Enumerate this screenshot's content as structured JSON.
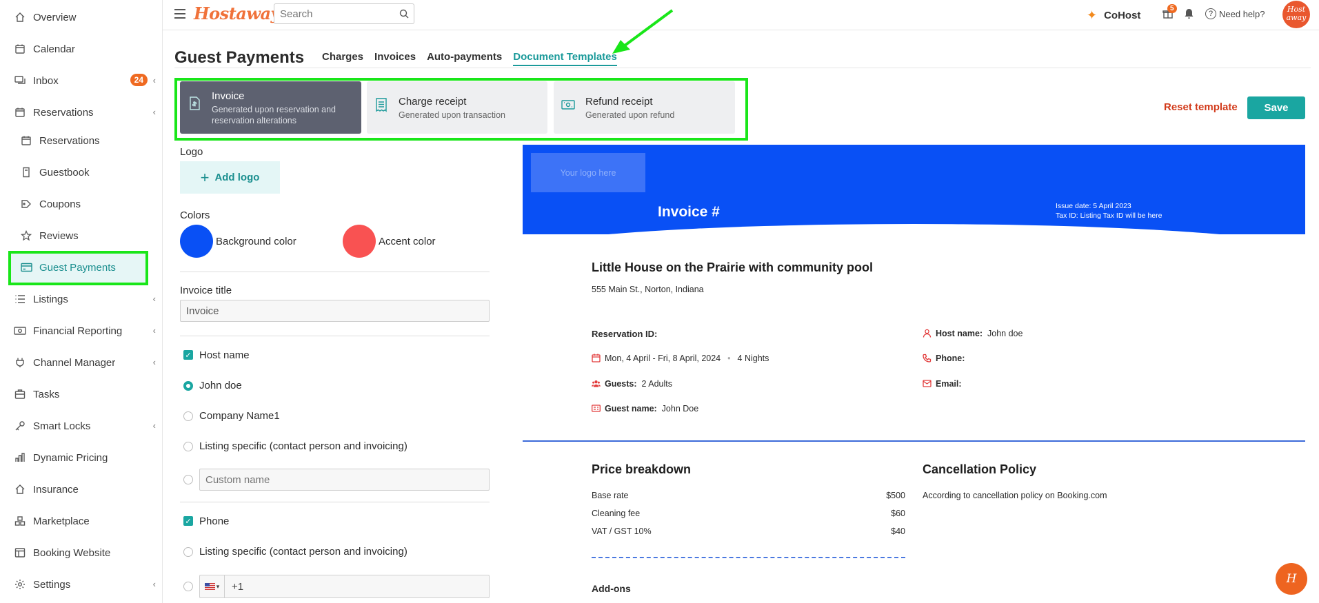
{
  "sidebar": {
    "items": [
      {
        "label": "Overview",
        "icon": "home-icon"
      },
      {
        "label": "Calendar",
        "icon": "calendar-icon"
      },
      {
        "label": "Inbox",
        "icon": "inbox-icon",
        "badge": "24"
      },
      {
        "label": "Reservations",
        "icon": "calendar-check-icon"
      },
      {
        "label": "Reservations",
        "icon": "calendar-icon"
      },
      {
        "label": "Guestbook",
        "icon": "book-icon"
      },
      {
        "label": "Coupons",
        "icon": "tag-icon"
      },
      {
        "label": "Reviews",
        "icon": "star-icon"
      },
      {
        "label": "Guest Payments",
        "icon": "credit-card-icon"
      },
      {
        "label": "Listings",
        "icon": "list-icon"
      },
      {
        "label": "Financial Reporting",
        "icon": "money-icon"
      },
      {
        "label": "Channel Manager",
        "icon": "plug-icon"
      },
      {
        "label": "Tasks",
        "icon": "briefcase-icon"
      },
      {
        "label": "Smart Locks",
        "icon": "key-icon"
      },
      {
        "label": "Dynamic Pricing",
        "icon": "bar-chart-icon"
      },
      {
        "label": "Insurance",
        "icon": "house-shield-icon"
      },
      {
        "label": "Marketplace",
        "icon": "marketplace-icon"
      },
      {
        "label": "Booking Website",
        "icon": "website-icon"
      },
      {
        "label": "Settings",
        "icon": "gear-icon"
      }
    ]
  },
  "topbar": {
    "logo": "Hostaway",
    "search_placeholder": "Search",
    "cohost_label": "CoHost",
    "gift_badge": "5",
    "help_label": "Need help?",
    "avatar_text": "Host away"
  },
  "header": {
    "title": "Guest Payments",
    "tabs": [
      "Charges",
      "Invoices",
      "Auto-payments",
      "Document Templates"
    ]
  },
  "templates": [
    {
      "title": "Invoice",
      "subtitle": "Generated upon reservation and reservation alterations"
    },
    {
      "title": "Charge receipt",
      "subtitle": "Generated upon transaction"
    },
    {
      "title": "Refund receipt",
      "subtitle": "Generated upon refund"
    }
  ],
  "actions": {
    "reset": "Reset template",
    "save": "Save"
  },
  "form": {
    "logo_label": "Logo",
    "add_logo": "Add logo",
    "colors_label": "Colors",
    "background_color_label": "Background color",
    "accent_color_label": "Accent color",
    "background_color": "#0950f5",
    "accent_color": "#f95252",
    "invoice_title_label": "Invoice title",
    "invoice_title_value": "Invoice",
    "host_name_label": "Host name",
    "host_options": [
      "John doe",
      "Company Name1",
      "Listing specific (contact person and invoicing)"
    ],
    "custom_name_placeholder": "Custom name",
    "phone_label": "Phone",
    "phone_options": [
      "Listing specific (contact person and invoicing)"
    ],
    "phone_prefix": "+1"
  },
  "preview": {
    "logo_placeholder": "Your logo here",
    "invoice_heading": "Invoice #",
    "issue_date": "Issue date:  5 April 2023",
    "tax_id": "Tax ID: Listing Tax ID will be here",
    "listing_name": "Little House on the Prairie with community pool",
    "address": "555 Main St., Norton, Indiana",
    "reservation_id_label": "Reservation ID:",
    "dates": "Mon, 4 April - Fri, 8 April, 2024",
    "nights": "4 Nights",
    "guests_label": "Guests:",
    "guests_value": "2 Adults",
    "guest_name_label": "Guest name:",
    "guest_name_value": "John Doe",
    "host_name_label": "Host name:",
    "host_name_value": "John doe",
    "phone_label": "Phone:",
    "email_label": "Email:",
    "price_breakdown_title": "Price breakdown",
    "price_rows": [
      {
        "label": "Base rate",
        "value": "$500"
      },
      {
        "label": "Cleaning fee",
        "value": "$60"
      },
      {
        "label": "VAT / GST 10%",
        "value": "$40"
      }
    ],
    "cancellation_title": "Cancellation Policy",
    "cancellation_text": "According to cancellation policy on Booking.com",
    "addons_title": "Add-ons"
  },
  "chat_button": "H"
}
